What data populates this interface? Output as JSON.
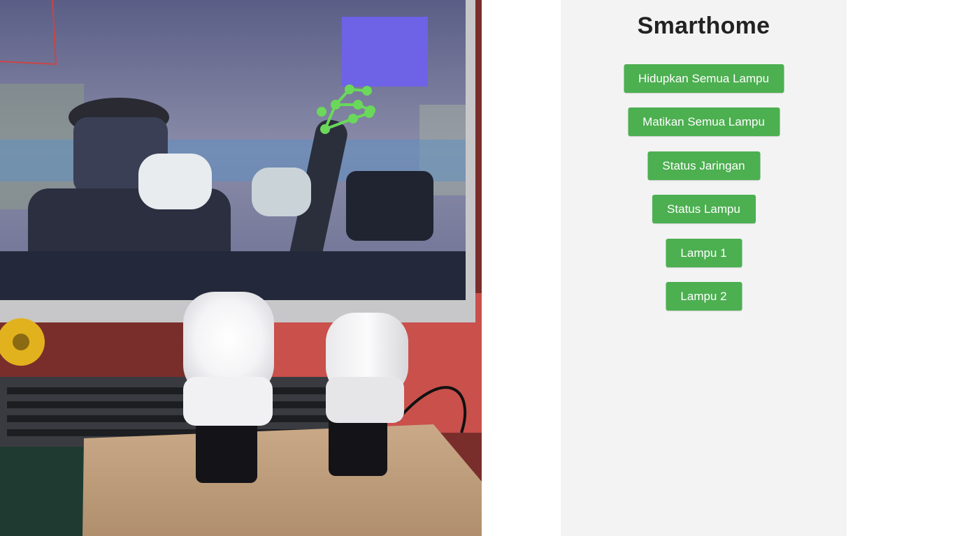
{
  "app": {
    "title": "Smarthome"
  },
  "buttons": {
    "all_on": "Hidupkan Semua Lampu",
    "all_off": "Matikan Semua Lampu",
    "network_status": "Status Jaringan",
    "lamp_status": "Status Lampu",
    "lamp_1": "Lampu 1",
    "lamp_2": "Lampu 2"
  },
  "colors": {
    "button_bg": "#4caf50",
    "button_text": "#ffffff",
    "panel_bg": "#f3f3f3",
    "title_text": "#222222"
  }
}
